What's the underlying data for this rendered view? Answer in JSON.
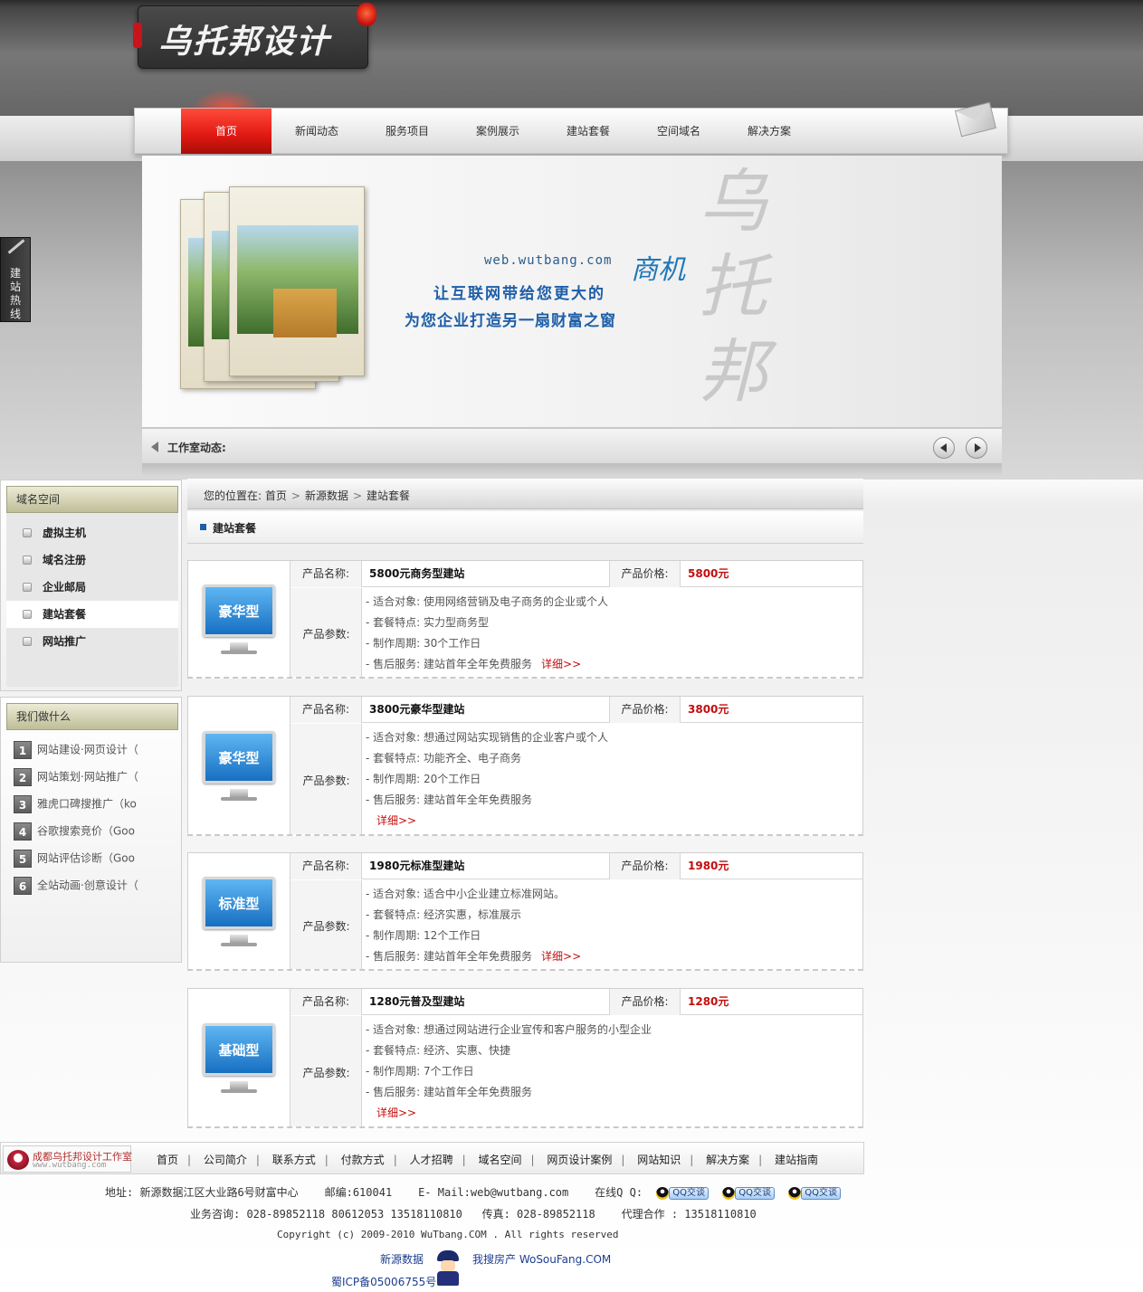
{
  "header": {
    "logo_text": "乌托邦设计"
  },
  "nav": {
    "items": [
      "首页",
      "新闻动态",
      "服务项目",
      "案例展示",
      "建站套餐",
      "空间域名",
      "解决方案"
    ],
    "active": "首页"
  },
  "banner": {
    "url": "web.wutbang.com",
    "line1": "让互联网带给您更大的",
    "line2": "为您企业打造另一扇财富之窗",
    "callig_small": "商机",
    "callig_big": "乌托邦",
    "bar_label": "工作室动态:"
  },
  "hotline": {
    "label": "建站热线"
  },
  "sidebar": {
    "box1": {
      "title": "域名空间",
      "items": [
        "虚拟主机",
        "域名注册",
        "企业邮局",
        "建站套餐",
        "网站推广"
      ],
      "active": "建站套餐"
    },
    "box2": {
      "title": "我们做什么",
      "items": [
        {
          "num": "1",
          "text": "网站建设·网页设计（"
        },
        {
          "num": "2",
          "text": "网站策划·网站推广（"
        },
        {
          "num": "3",
          "text": "雅虎口碑搜推广（ko"
        },
        {
          "num": "4",
          "text": "谷歌搜索竞价（Goo"
        },
        {
          "num": "5",
          "text": "网站评估诊断（Goo"
        },
        {
          "num": "6",
          "text": "全站动画·创意设计（"
        }
      ]
    }
  },
  "breadcrumb": {
    "prefix": "您的位置在:",
    "items": [
      "首页",
      "新源数据",
      "建站套餐"
    ]
  },
  "section_title": "建站套餐",
  "labels": {
    "name": "产品名称:",
    "price": "产品价格:",
    "params": "产品参数:",
    "detail": "详细>>"
  },
  "products": [
    {
      "screen": "豪华型",
      "name": "5800元商务型建站",
      "price": "5800元",
      "params": [
        "- 适合对象: 使用网络营销及电子商务的企业或个人",
        "- 套餐特点: 实力型商务型",
        "- 制作周期: 30个工作日",
        "- 售后服务: 建站首年全年免费服务"
      ]
    },
    {
      "screen": "豪华型",
      "name": "3800元豪华型建站",
      "price": "3800元",
      "params": [
        "- 适合对象: 想通过网站实现销售的企业客户或个人",
        "- 套餐特点: 功能齐全、电子商务",
        "- 制作周期: 20个工作日",
        "- 售后服务: 建站首年全年免费服务"
      ]
    },
    {
      "screen": "标准型",
      "name": "1980元标准型建站",
      "price": "1980元",
      "params": [
        "- 适合对象: 适合中小企业建立标准网站。",
        "- 套餐特点: 经济实惠，标准展示",
        "- 制作周期: 12个工作日",
        "- 售后服务: 建站首年全年免费服务"
      ]
    },
    {
      "screen": "基础型",
      "name": "1280元普及型建站",
      "price": "1280元",
      "params": [
        "- 适合对象: 想通过网站进行企业宣传和客户服务的小型企业",
        "- 套餐特点: 经济、实惠、快捷",
        "- 制作周期: 7个工作日",
        "- 售后服务: 建站首年全年免费服务"
      ]
    }
  ],
  "footer": {
    "logo_line1": "成都乌托邦设计工作室",
    "logo_line2": "www.wutbang.com",
    "links": [
      "首页",
      "公司简介",
      "联系方式",
      "付款方式",
      "人才招聘",
      "域名空间",
      "网页设计案例",
      "网站知识",
      "解决方案",
      "建站指南"
    ],
    "address": "地址: 新源数据江区大业路6号财富中心",
    "zip": "邮编:610041",
    "email": "E- Mail:web@wutbang.com",
    "online_qq": "在线Q Q:",
    "qq_badge": "QQ交谈",
    "phone": "业务咨询: 028-89852118 80612053  13518110810",
    "fax": "传真: 028-89852118",
    "agent": "代理合作 : 13518110810",
    "copyright": "Copyright (c) 2009-2010 WuTbang.COM . All rights reserved",
    "friend1": "新源数据",
    "friend2": "我搜房产 WoSouFang.COM",
    "icp": "蜀ICP备05006755号"
  }
}
